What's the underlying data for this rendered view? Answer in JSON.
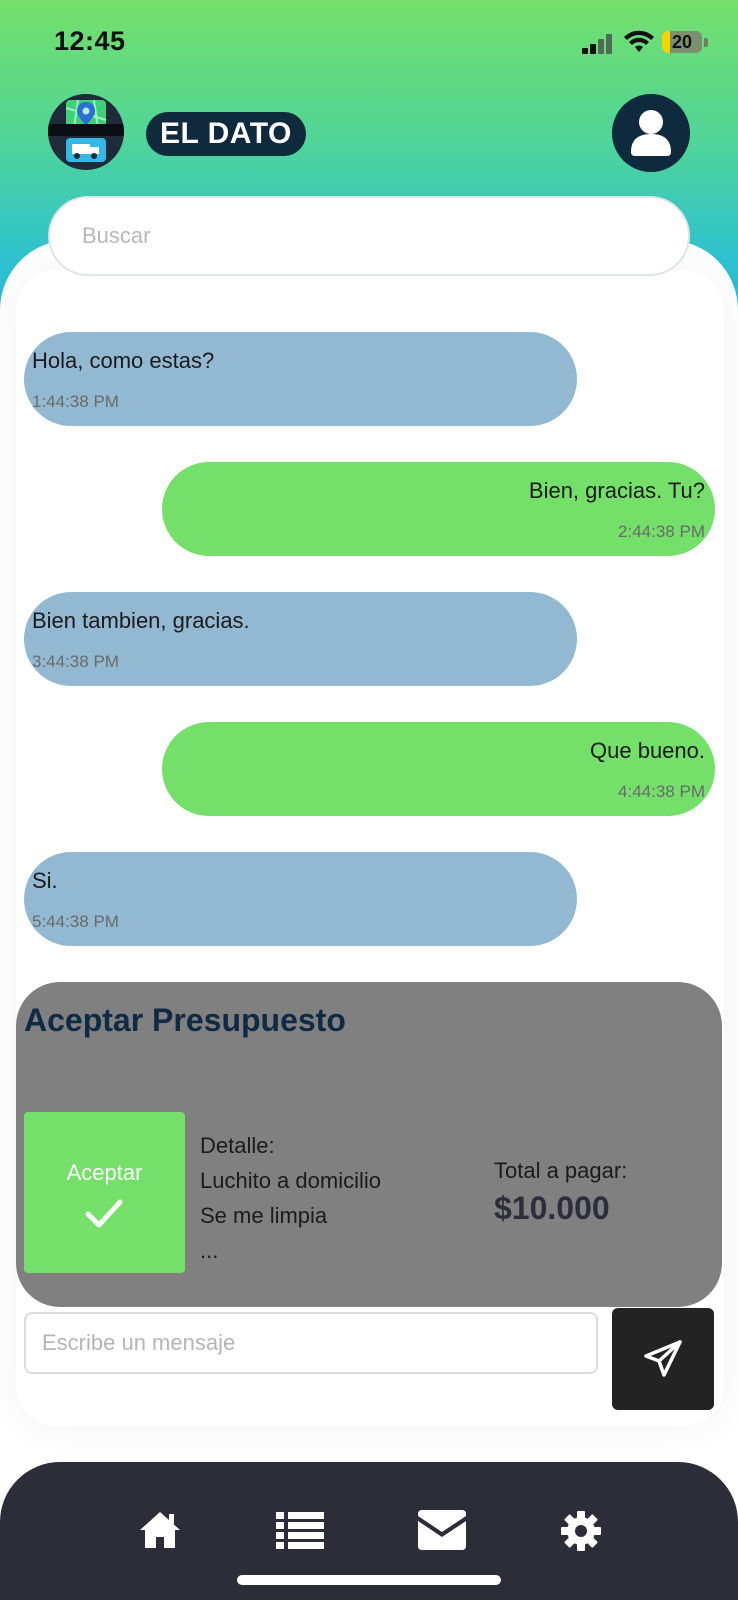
{
  "status_bar": {
    "time": "12:45",
    "battery": "20",
    "battery_level": 0.2
  },
  "header": {
    "brand": "EL DATO",
    "logo_icon": "map-truck-logo",
    "avatar_icon": "user-icon"
  },
  "search": {
    "placeholder": "Buscar"
  },
  "messages": [
    {
      "direction": "in",
      "text": "Hola, como estas?",
      "time": "1:44:38 PM"
    },
    {
      "direction": "out",
      "text": "Bien, gracias. Tu?",
      "time": "2:44:38 PM"
    },
    {
      "direction": "in",
      "text": "Bien tambien, gracias.",
      "time": "3:44:38 PM"
    },
    {
      "direction": "out",
      "text": "Que bueno.",
      "time": "4:44:38 PM"
    },
    {
      "direction": "in",
      "text": "Si.",
      "time": "5:44:38 PM"
    }
  ],
  "budget": {
    "title": "Aceptar Presupuesto",
    "accept_label": "Aceptar",
    "detail_label": "Detalle:",
    "detail_lines": [
      "Luchito a domicilio",
      "Se me limpia",
      "..."
    ],
    "total_label": "Total a pagar:",
    "total_value": "$10.000"
  },
  "composer": {
    "placeholder": "Escribe un mensaje",
    "send_icon": "send-icon"
  },
  "nav": {
    "items": [
      "home-icon",
      "list-icon",
      "mail-icon",
      "settings-icon"
    ]
  },
  "colors": {
    "incoming_bubble": "#93b9d2",
    "outgoing_bubble": "#74e06a",
    "brand_navy": "#0f2a3c",
    "card_gray": "#808080",
    "nav_bg": "#2d2d3a"
  }
}
